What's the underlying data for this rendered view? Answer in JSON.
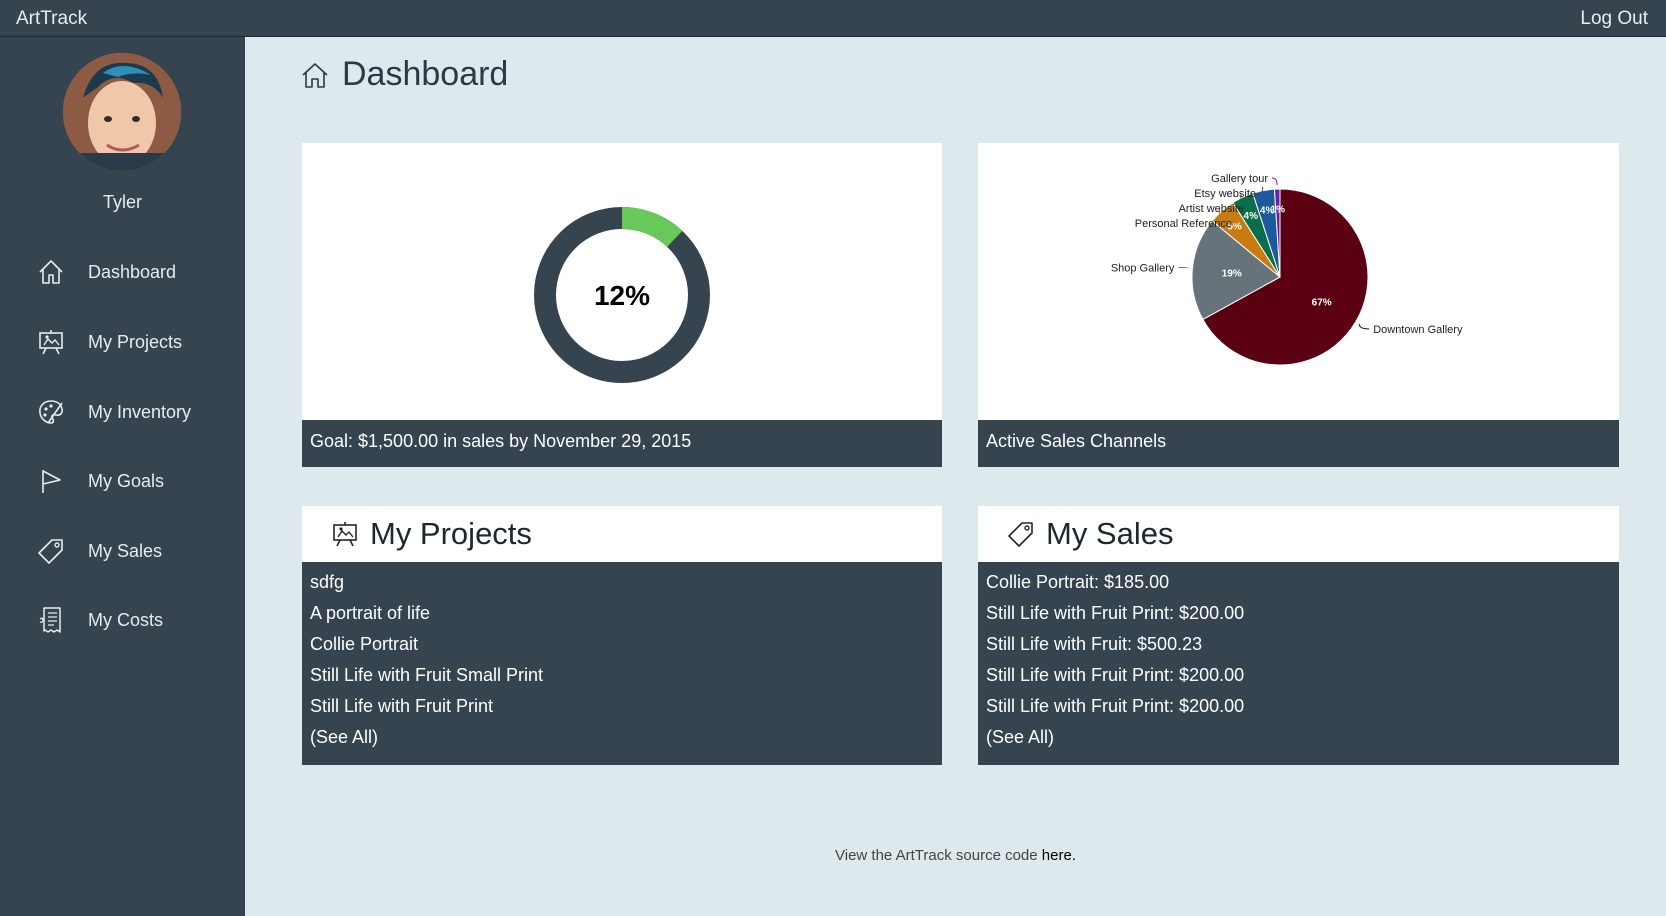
{
  "app": {
    "brand": "ArtTrack",
    "logout_label": "Log Out"
  },
  "user": {
    "name": "Tyler"
  },
  "sidebar": {
    "items": [
      {
        "label": "Dashboard",
        "icon": "home-icon"
      },
      {
        "label": "My Projects",
        "icon": "easel-icon"
      },
      {
        "label": "My Inventory",
        "icon": "palette-icon"
      },
      {
        "label": "My Goals",
        "icon": "flag-icon"
      },
      {
        "label": "My Sales",
        "icon": "tag-icon"
      },
      {
        "label": "My Costs",
        "icon": "receipt-icon"
      }
    ]
  },
  "page": {
    "title": "Dashboard"
  },
  "goal": {
    "percent": 12,
    "percent_label": "12%",
    "caption": "Goal: $1,500.00 in sales by November 29, 2015",
    "colors": {
      "progress": "#66c95a",
      "track": "#36444f"
    }
  },
  "channels": {
    "caption": "Active Sales Channels"
  },
  "chart_data": {
    "type": "pie",
    "slices": [
      {
        "label": "Downtown Gallery",
        "value": 67,
        "value_label": "67%",
        "color": "#5a0012"
      },
      {
        "label": "Shop Gallery",
        "value": 19,
        "value_label": "19%",
        "color": "#66737a"
      },
      {
        "label": "Personal Reference",
        "value": 5,
        "value_label": "5%",
        "color": "#c97a10"
      },
      {
        "label": "Artist website",
        "value": 4,
        "value_label": "4%",
        "color": "#0b6e4a"
      },
      {
        "label": "Etsy website",
        "value": 4,
        "value_label": "4%",
        "color": "#1d5a9c"
      },
      {
        "label": "Gallery tour",
        "value": 1,
        "value_label": "1%",
        "color": "#6a1fa8"
      }
    ]
  },
  "projects": {
    "title": "My Projects",
    "items": [
      "sdfg",
      "A portrait of life",
      "Collie Portrait",
      "Still Life with Fruit Small Print",
      "Still Life with Fruit Print"
    ],
    "see_all": "(See All)"
  },
  "sales": {
    "title": "My Sales",
    "items": [
      "Collie Portrait: $185.00",
      "Still Life with Fruit Print: $200.00",
      "Still Life with Fruit: $500.23",
      "Still Life with Fruit Print: $200.00",
      "Still Life with Fruit Print: $200.00"
    ],
    "see_all": "(See All)"
  },
  "footer": {
    "text": "View the ArtTrack source code ",
    "link": "here."
  }
}
